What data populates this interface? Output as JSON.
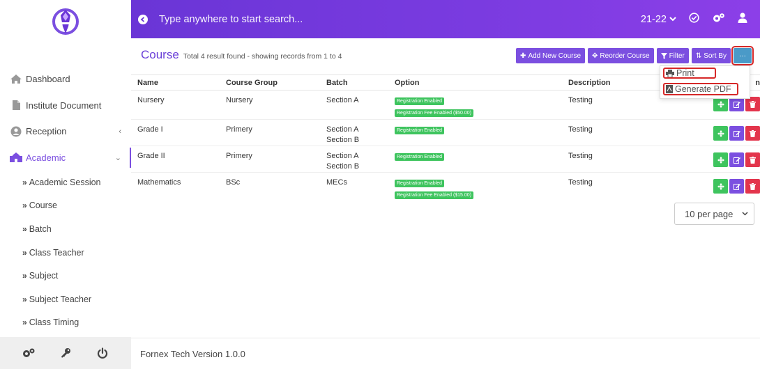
{
  "header": {
    "search_placeholder": "Type anywhere to start search...",
    "year": "21-22"
  },
  "sidebar": {
    "items": [
      {
        "label": "Dashboard"
      },
      {
        "label": "Institute Document"
      },
      {
        "label": "Reception"
      },
      {
        "label": "Academic"
      }
    ],
    "sub_items": [
      {
        "label": "Academic Session"
      },
      {
        "label": "Course"
      },
      {
        "label": "Batch"
      },
      {
        "label": "Class Teacher"
      },
      {
        "label": "Subject"
      },
      {
        "label": "Subject Teacher"
      },
      {
        "label": "Class Timing"
      }
    ]
  },
  "page": {
    "title": "Course",
    "subtitle": "Total 4 result found - showing records from 1 to 4"
  },
  "toolbar": {
    "add_label": "Add New Course",
    "reorder_label": "Reorder Course",
    "filter_label": "Filter",
    "sort_label": "Sort By",
    "more_label": "···"
  },
  "dropdown": {
    "print_label": "Print",
    "pdf_label": "Generate PDF"
  },
  "table": {
    "headers": [
      "Name",
      "Course Group",
      "Batch",
      "Option",
      "Description",
      "n"
    ],
    "rows": [
      {
        "name": "Nursery",
        "group": "Nursery",
        "batch1": "Section A",
        "batch2": "",
        "badge1": "Registration Enabled",
        "badge2": "Registration Fee Enabled ($50.00)",
        "description": "Testing"
      },
      {
        "name": "Grade I",
        "group": "Primery",
        "batch1": "Section A",
        "batch2": "Section B",
        "badge1": "Registration Enabled",
        "badge2": "",
        "description": "Testing"
      },
      {
        "name": "Grade II",
        "group": "Primery",
        "batch1": "Section A",
        "batch2": "Section B",
        "badge1": "Registration Enabled",
        "badge2": "",
        "description": "Testing"
      },
      {
        "name": "Mathematics",
        "group": "BSc",
        "batch1": "MECs",
        "batch2": "",
        "badge1": "Registration Enabled",
        "badge2": "Registration Fee Enabled ($15.00)",
        "description": "Testing"
      }
    ]
  },
  "pagination": {
    "per_page": "10 per page"
  },
  "footer": {
    "version": "Fornex Tech Version 1.0.0"
  },
  "colors": {
    "accent": "#7b4fe0",
    "success": "#3ec45e",
    "danger": "#e3354c",
    "highlight": "#d62828"
  }
}
